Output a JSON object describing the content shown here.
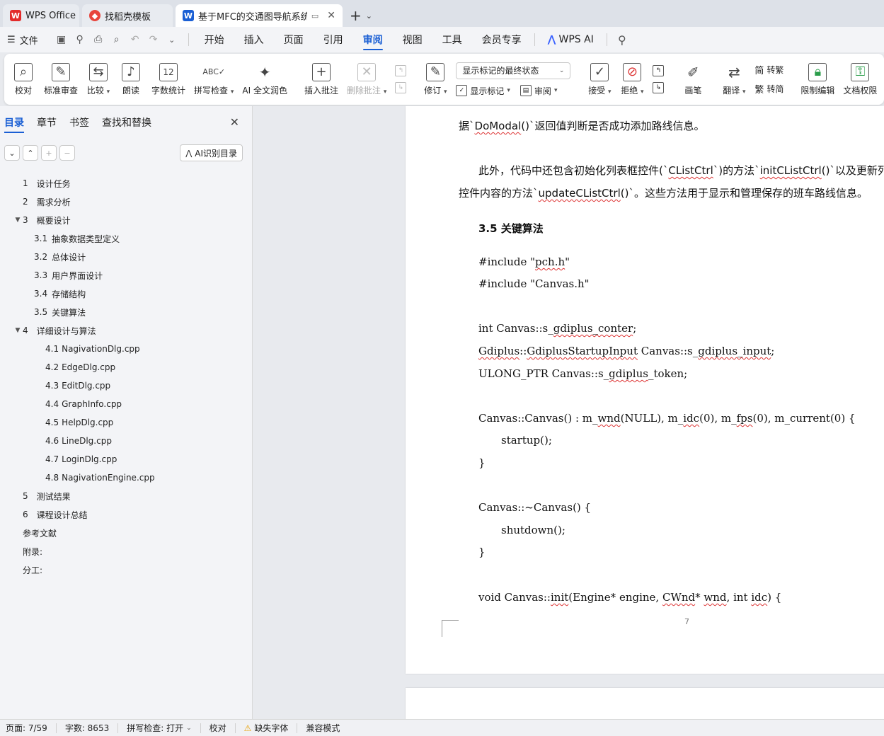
{
  "tabs": [
    {
      "label": "WPS Office",
      "icon": "wps-logo-icon",
      "color": "#e32b2b"
    },
    {
      "label": "找稻壳模板",
      "icon": "docer-logo-icon",
      "color": "#e8453c"
    },
    {
      "label": "基于MFC的交通图导航系统 课",
      "icon": "writer-doc-icon",
      "color": "#1a5fd4"
    }
  ],
  "menubar": {
    "file_label": "文件",
    "tabs": [
      "开始",
      "插入",
      "页面",
      "引用",
      "审阅",
      "视图",
      "工具",
      "会员专享"
    ],
    "active_tab": "审阅",
    "wps_ai": "WPS AI"
  },
  "ribbon": {
    "proofread": "校对",
    "std_review": "标准审查",
    "compare": "比较",
    "read_aloud": "朗读",
    "word_count": "字数统计",
    "spell_check": "拼写检查",
    "ai_polish": "AI 全文润色",
    "insert_comment": "插入批注",
    "delete_comment": "删除批注",
    "revise": "修订",
    "markup_mode": "显示标记的最终状态",
    "show_markup": "显示标记",
    "review": "审阅",
    "accept": "接受",
    "reject": "拒绝",
    "pen": "画笔",
    "translate": "翻译",
    "to_traditional": "转繁",
    "to_simplified": "转简",
    "restrict_edit": "限制编辑",
    "doc_auth": "文档权限"
  },
  "nav": {
    "tabs": [
      "目录",
      "章节",
      "书签",
      "查找和替换"
    ],
    "active_tab": "目录",
    "ai_toc": "AI识别目录",
    "toc": [
      {
        "level": 1,
        "num": "1",
        "label": "设计任务"
      },
      {
        "level": 1,
        "num": "2",
        "label": "需求分析"
      },
      {
        "level": 1,
        "num": "3",
        "label": "概要设计",
        "expanded": true
      },
      {
        "level": 2,
        "num": "3.1",
        "label": "抽象数据类型定义"
      },
      {
        "level": 2,
        "num": "3.2",
        "label": "总体设计"
      },
      {
        "level": 2,
        "num": "3.3",
        "label": "用户界面设计"
      },
      {
        "level": 2,
        "num": "3.4",
        "label": "存储结构"
      },
      {
        "level": 2,
        "num": "3.5",
        "label": "关键算法"
      },
      {
        "level": 1,
        "num": "4",
        "label": "详细设计与算法",
        "expanded": true
      },
      {
        "level": 3,
        "num": "4.1",
        "label": "NagivationDlg.cpp"
      },
      {
        "level": 3,
        "num": "4.2",
        "label": "EdgeDlg.cpp"
      },
      {
        "level": 3,
        "num": "4.3",
        "label": "EditDlg.cpp"
      },
      {
        "level": 3,
        "num": "4.4",
        "label": "GraphInfo.cpp"
      },
      {
        "level": 3,
        "num": "4.5",
        "label": "HelpDlg.cpp"
      },
      {
        "level": 3,
        "num": "4.6",
        "label": "LineDlg.cpp"
      },
      {
        "level": 3,
        "num": "4.7",
        "label": "LoginDlg.cpp"
      },
      {
        "level": 3,
        "num": "4.8",
        "label": "NagivationEngine.cpp"
      },
      {
        "level": 1,
        "num": "5",
        "label": "测试结果"
      },
      {
        "level": 1,
        "num": "6",
        "label": "课程设计总结"
      },
      {
        "level": 1,
        "num": "",
        "label": "参考文献"
      },
      {
        "level": 1,
        "num": "",
        "label": "附录:"
      },
      {
        "level": 1,
        "num": "",
        "label": "分工:"
      }
    ]
  },
  "doc": {
    "line_top": "据`DoModal()`返回值判断是否成功添加路线信息。",
    "para2_a": "此外，代码中还包含初始化列表框控件(`CListCtrl`)的方法`initCListCtrl()`以及更新列",
    "para2_b": "控件内容的方法`updateCListCtrl()`。这些方法用于显示和管理保存的班车路线信息。",
    "heading": "3.5  关键算法",
    "code": [
      "#include \"pch.h\"",
      "#include \"Canvas.h\"",
      "int Canvas::s_gdiplus_conter;",
      "Gdiplus::GdiplusStartupInput Canvas::s_gdiplus_input;",
      "ULONG_PTR Canvas::s_gdiplus_token;",
      "Canvas::Canvas() : m_wnd(NULL), m_idc(0), m_fps(0), m_current(0) {",
      "startup();",
      "}",
      "Canvas::~Canvas() {",
      "shutdown();",
      "}",
      "void Canvas::init(Engine* engine, CWnd* wnd, int idc) {"
    ],
    "page_number": "7"
  },
  "status": {
    "page": "页面: 7/59",
    "words": "字数: 8653",
    "spell": "拼写检查: 打开",
    "proof": "校对",
    "missing_font": "缺失字体",
    "compat": "兼容模式"
  }
}
